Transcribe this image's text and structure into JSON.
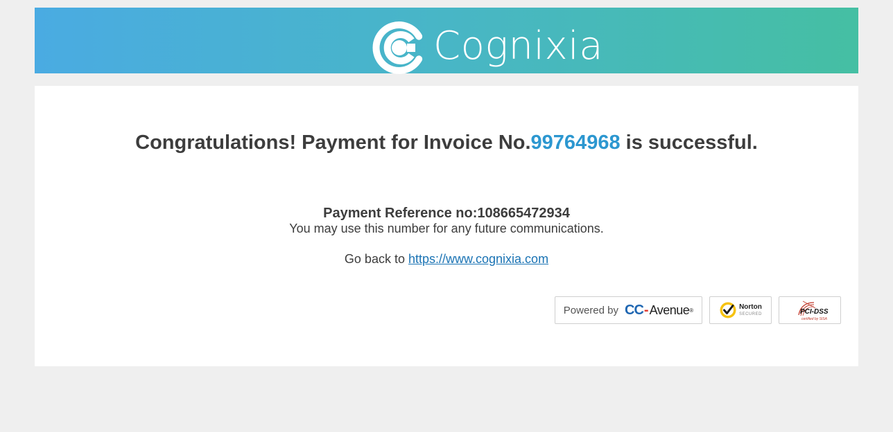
{
  "header": {
    "brand_name": "Cognixia",
    "logo_icon": "cognixia-c-logo-icon",
    "gradient_colors": [
      "#4aabe2",
      "#45bfa3"
    ]
  },
  "confirmation": {
    "headline_prefix": "Congratulations! Payment for Invoice No.",
    "invoice_number": "99764968",
    "headline_suffix": " is successful.",
    "reference_label": "Payment Reference no:",
    "reference_number": "108665472934",
    "note": "You may use this number for any future communications.",
    "go_back_prefix": "Go back to ",
    "go_back_link": "https://www.cognixia.com"
  },
  "badges": {
    "ccavenue": {
      "powered_by": "Powered by",
      "cc": "CC",
      "dash": "-",
      "avenue": "Avenue",
      "reg": "®"
    },
    "norton": {
      "brand": "Norton",
      "sub": "SECURED",
      "icon": "checkmark-seal-icon"
    },
    "pci": {
      "brand": "PCI-DSS",
      "sub": "certified by SISA",
      "icon": "pci-arc-icon"
    }
  },
  "colors": {
    "page_background": "#efefef",
    "invoice_highlight": "#2c97d0",
    "link": "#1a73b4",
    "text": "#3d3d3d"
  }
}
